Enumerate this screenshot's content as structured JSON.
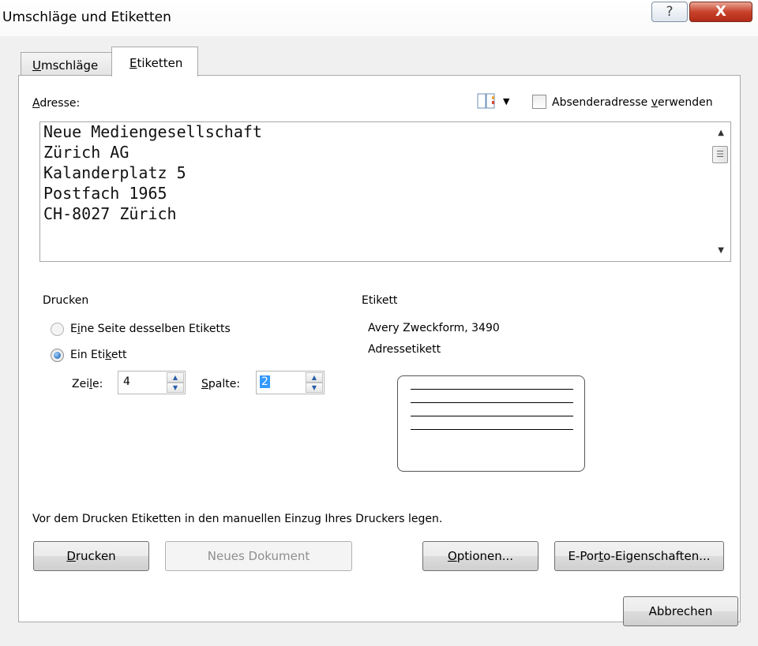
{
  "window": {
    "title": "Umschläge und Etiketten",
    "help_glyph": "?",
    "close_glyph": "X"
  },
  "tabs": [
    {
      "label": "Umschläge",
      "mnemonic": "U",
      "rest": "mschläge",
      "active": false
    },
    {
      "label": "Etiketten",
      "mnemonic": "E",
      "rest": "tiketten",
      "active": true
    }
  ],
  "address": {
    "label_mn": "A",
    "label_rest": "dresse:",
    "lines": [
      "Neue Mediengesellschaft",
      "Zürich AG",
      "Kalanderplatz 5",
      "Postfach 1965",
      "CH-8027 Zürich"
    ],
    "use_sender_pre": "Absenderadresse ",
    "use_sender_mn": "v",
    "use_sender_post": "erwenden",
    "use_sender_checked": false,
    "book_icon": "address-book-icon"
  },
  "print_group": {
    "label": "Drucken",
    "option_page_pre": "E",
    "option_page_mn": "i",
    "option_page_post": "ne Seite desselben Etiketts",
    "option_single_pre": "Ein Eti",
    "option_single_mn": "k",
    "option_single_post": "ett",
    "selected": "single",
    "row_label_pre": "Zei",
    "row_label_mn": "l",
    "row_label_post": "e:",
    "row_value": "4",
    "col_label_mn": "S",
    "col_label_post": "palte:",
    "col_value": "2"
  },
  "label_group": {
    "label": "Etikett",
    "vendor": "Avery Zweckform, 3490",
    "type": "Adressetikett"
  },
  "note": "Vor dem Drucken Etiketten in den manuellen Einzug Ihres Druckers legen.",
  "buttons": {
    "print_mn": "D",
    "print_rest": "rucken",
    "new_document": "Neues Dokument",
    "options_mn": "O",
    "options_rest": "ptionen...",
    "eporto_pre": "E-Por",
    "eporto_mn": "t",
    "eporto_post": "o-Eigenschaften...",
    "cancel": "Abbrechen"
  },
  "colors": {
    "selection": "#3399ff",
    "close_button": "#c9432c"
  }
}
